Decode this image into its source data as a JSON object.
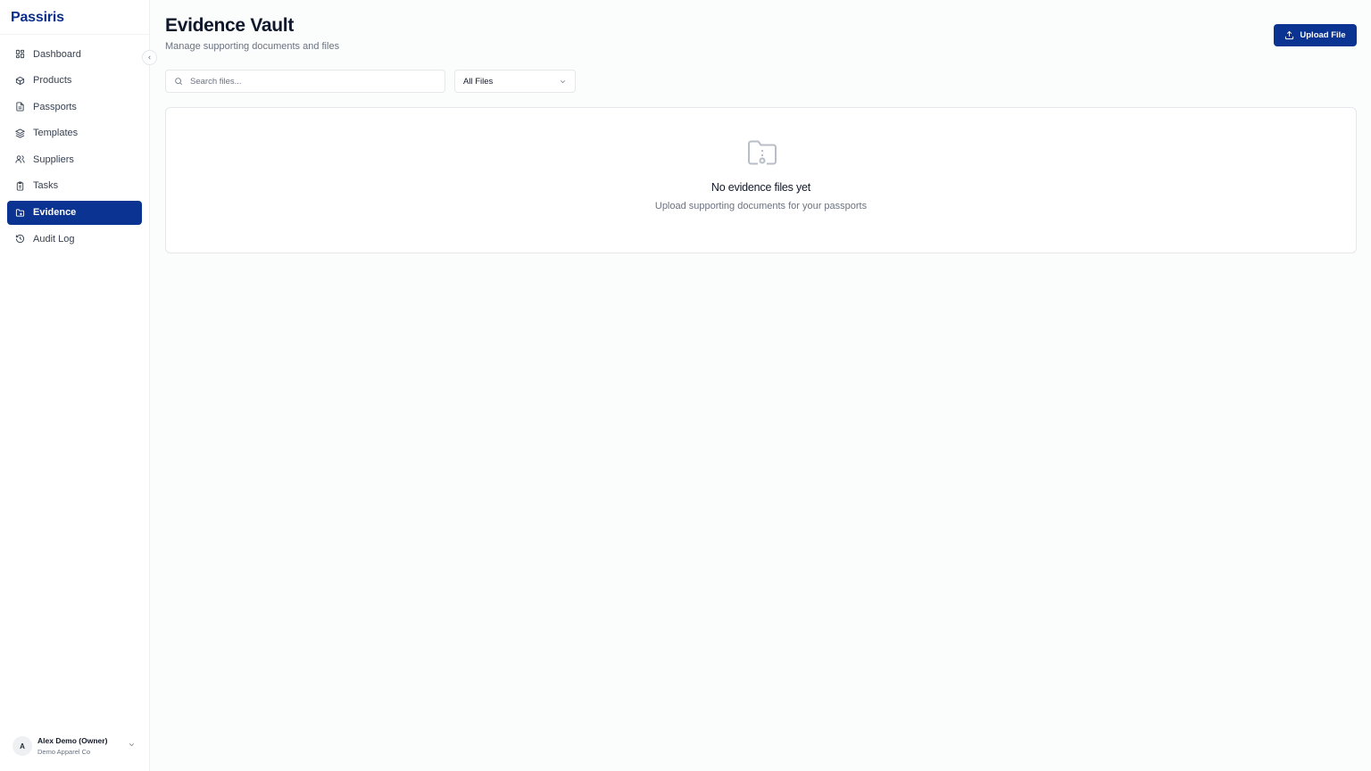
{
  "app": {
    "brand": "Passiris"
  },
  "sidebar": {
    "items": [
      {
        "label": "Dashboard",
        "icon": "dashboard-icon"
      },
      {
        "label": "Products",
        "icon": "package-icon"
      },
      {
        "label": "Passports",
        "icon": "document-icon"
      },
      {
        "label": "Templates",
        "icon": "layers-icon"
      },
      {
        "label": "Suppliers",
        "icon": "users-icon"
      },
      {
        "label": "Tasks",
        "icon": "clipboard-icon"
      },
      {
        "label": "Evidence",
        "icon": "folder-icon",
        "active": true
      },
      {
        "label": "Audit Log",
        "icon": "history-icon"
      }
    ],
    "user": {
      "initial": "A",
      "name": "Alex Demo (Owner)",
      "org": "Demo Apparel Co"
    }
  },
  "header": {
    "title": "Evidence Vault",
    "subtitle": "Manage supporting documents and files",
    "upload_label": "Upload File"
  },
  "filters": {
    "search_placeholder": "Search files...",
    "search_value": "",
    "type_selected": "All Files"
  },
  "empty_state": {
    "title": "No evidence files yet",
    "subtitle": "Upload supporting documents for your passports"
  },
  "colors": {
    "accent": "#0b3391",
    "brand": "#0b2f8a"
  }
}
